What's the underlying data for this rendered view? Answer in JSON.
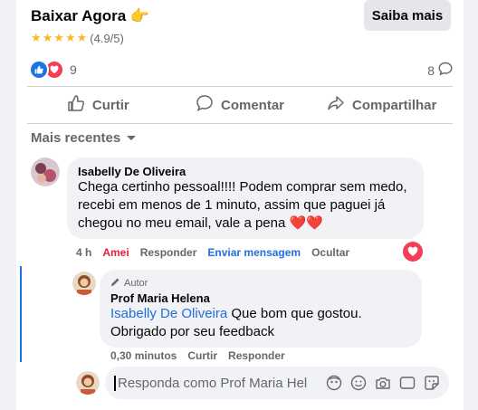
{
  "ad": {
    "title": "Baixar Agora",
    "emoji": "👉",
    "stars": "★★★★★",
    "rating": "(4.9/5)",
    "cta_label": "Saiba mais"
  },
  "post": {
    "reaction_count": "9",
    "comment_count": "8"
  },
  "actions": {
    "like": "Curtir",
    "comment": "Comentar",
    "share": "Compartilhar"
  },
  "sort": {
    "label": "Mais recentes"
  },
  "comment1": {
    "author": "Isabelly De Oliveira",
    "text": "Chega certinho pessoal!!!! Podem comprar sem medo, recebi em menos de 1 minuto, assim que paguei já chegou no meu email, vale a pena ❤️❤️",
    "time": "4 h",
    "reacted": "Amei",
    "reply": "Responder",
    "message": "Enviar mensagem",
    "hide": "Ocultar"
  },
  "reply1": {
    "badge": "Autor",
    "author": "Prof Maria Helena",
    "mention": "Isabelly De Oliveira",
    "text": " Que bom que gostou. Obrigado por seu feedback",
    "time": "0,30 minutos",
    "like": "Curtir",
    "reply": "Responder"
  },
  "reply_box": {
    "placeholder": "Responda como Prof Maria Helena"
  },
  "icons": [
    "thumbs-up-icon",
    "heart-icon",
    "comment-icon",
    "share-icon",
    "caret-down-icon",
    "pencil-icon",
    "avatar-sticker-icon",
    "emoji-icon",
    "camera-icon",
    "gif-icon",
    "sticker-icon"
  ]
}
